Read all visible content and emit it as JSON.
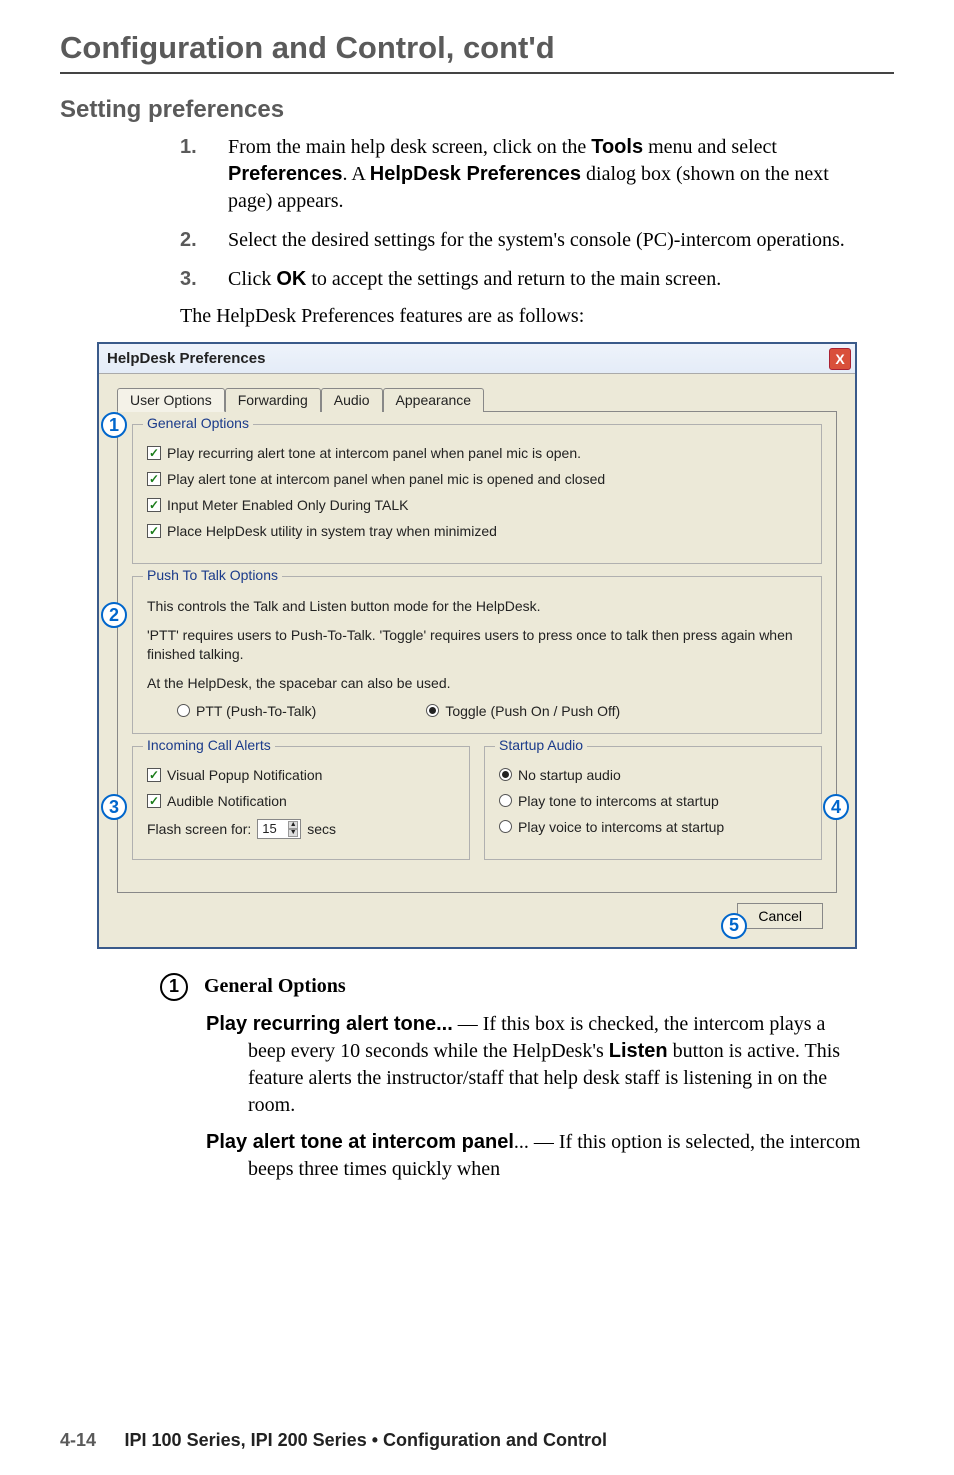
{
  "headings": {
    "main": "Configuration and Control, cont'd",
    "section": "Setting preferences"
  },
  "steps": [
    {
      "num": "1.",
      "prefix": "From the main  help desk screen, click on the ",
      "bold1": "Tools",
      "mid1": " menu and select ",
      "bold2": "Preferences",
      "mid2": ".   A ",
      "bold3": "HelpDesk  Preferences",
      "tail": " dialog box (shown on the next page) appears."
    },
    {
      "num": "2.",
      "text": "Select the desired settings for the system's console (PC)-intercom operations."
    },
    {
      "num": "3.",
      "prefix": "Click ",
      "bold1": "OK",
      "tail": " to accept the settings and return to the main screen."
    }
  ],
  "follow_text": "The HelpDesk Preferences features are as follows:",
  "dialog": {
    "title": "HelpDesk Preferences",
    "close": "X",
    "tabs": [
      "User Options",
      "Forwarding",
      "Audio",
      "Appearance"
    ],
    "general": {
      "title": "General Options",
      "c1": "Play recurring alert tone at intercom panel when panel mic is open.",
      "c2": "Play alert tone at intercom panel when panel mic is opened and closed",
      "c3": "Input Meter Enabled Only During TALK",
      "c4": "Place HelpDesk utility in system tray when minimized"
    },
    "ptt": {
      "title": "Push To Talk Options",
      "p1": "This controls the Talk and Listen button mode for the HelpDesk.",
      "p2": "'PTT' requires users to Push-To-Talk.  'Toggle' requires users to press once to talk then press again when finished talking.",
      "p3": "At the HelpDesk, the spacebar can also be used.",
      "r1": "PTT (Push-To-Talk)",
      "r2": "Toggle (Push On / Push Off)"
    },
    "incoming": {
      "title": "Incoming Call Alerts",
      "c1": "Visual Popup Notification",
      "c2": "Audible Notification",
      "flash_label": "Flash screen for:",
      "flash_val": "15",
      "secs": "secs"
    },
    "startup": {
      "title": "Startup Audio",
      "r1": "No startup audio",
      "r2": "Play tone to intercoms at startup",
      "r3": "Play voice to intercoms at startup"
    },
    "buttons": {
      "cancel": "Cancel"
    }
  },
  "callouts": {
    "c1": "1",
    "c2": "2",
    "c3": "3",
    "c4": "4",
    "c5": "5"
  },
  "legend": {
    "num": "1",
    "title": "General Options",
    "item1": {
      "lead": "Play recurring alert tone...",
      "body": " — If this box is checked, the intercom plays a beep every 10 seconds while the HelpDesk's ",
      "bold": "Listen",
      "tail": " button is active.   This feature alerts the instructor/staff that help desk staff is listening in on the room."
    },
    "item2": {
      "lead": "Play alert tone at intercom panel",
      "body": "... — If this option is selected, the intercom beeps three times quickly when"
    }
  },
  "footer": {
    "page": "4-14",
    "rest": "IPI 100 Series, IPI 200 Series • Configuration and Control"
  }
}
